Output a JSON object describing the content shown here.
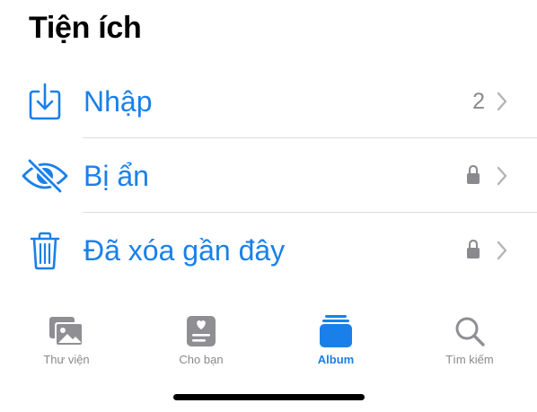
{
  "section": {
    "title": "Tiện ích"
  },
  "rows": [
    {
      "label": "Nhập",
      "count": "2",
      "icon": "import-icon",
      "locked": false
    },
    {
      "label": "Bị ẩn",
      "count": "",
      "icon": "eye-slash-icon",
      "locked": true
    },
    {
      "label": "Đã xóa gần đây",
      "count": "",
      "icon": "trash-icon",
      "locked": true
    }
  ],
  "tabbar": {
    "tabs": [
      {
        "label": "Thư viện",
        "icon": "photo-library-icon",
        "active": false
      },
      {
        "label": "Cho bạn",
        "icon": "for-you-icon",
        "active": false
      },
      {
        "label": "Album",
        "icon": "album-icon",
        "active": true
      },
      {
        "label": "Tìm kiếm",
        "icon": "search-icon",
        "active": false
      }
    ]
  },
  "colors": {
    "accent": "#1a80e9",
    "secondary_text": "#8a8a8e",
    "divider": "#dcdce0",
    "inactive_icon": "#8e8e93"
  }
}
